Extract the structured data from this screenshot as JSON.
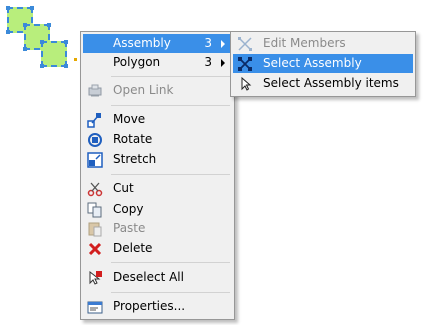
{
  "context_menu": {
    "items": [
      {
        "label": "Assembly",
        "count": "3",
        "icon": "none"
      },
      {
        "label": "Polygon",
        "count": "3",
        "icon": "none"
      },
      {
        "label": "Open Link",
        "icon": "open-link-icon",
        "disabled": true
      },
      {
        "label": "Move",
        "icon": "move-icon"
      },
      {
        "label": "Rotate",
        "icon": "rotate-icon"
      },
      {
        "label": "Stretch",
        "icon": "stretch-icon"
      },
      {
        "label": "Cut",
        "icon": "scissors-icon"
      },
      {
        "label": "Copy",
        "icon": "copy-icon"
      },
      {
        "label": "Paste",
        "icon": "paste-icon",
        "disabled": true
      },
      {
        "label": "Delete",
        "icon": "delete-x-icon"
      },
      {
        "label": "Deselect All",
        "icon": "deselect-icon"
      },
      {
        "label": "Properties...",
        "icon": "properties-icon"
      }
    ]
  },
  "submenu": {
    "items": [
      {
        "label": "Edit Members",
        "disabled": true,
        "icon": "edit-members-icon"
      },
      {
        "label": "Select Assembly",
        "icon": "select-assembly-icon"
      },
      {
        "label": "Select Assembly items",
        "icon": "cursor-icon"
      }
    ]
  },
  "colors": {
    "highlight": "#3a8fe8",
    "shape_fill": "#b8ee7c",
    "shape_border": "#3b8ad9"
  }
}
